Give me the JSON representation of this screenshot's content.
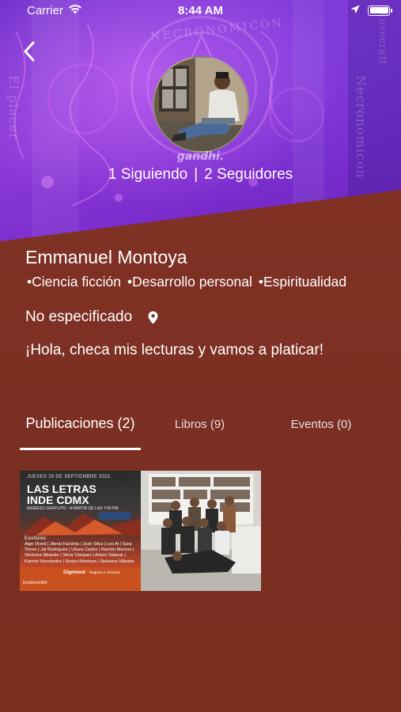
{
  "status_bar": {
    "carrier": "Carrier",
    "time": "8:44 AM",
    "battery_level": 1.0
  },
  "banner": {
    "brand_logo": "gandhi.",
    "top_text": "NECRONOMICON",
    "side_text_left": "El placer",
    "side_text_right": "Necronomicon",
    "side_text_right_small": "Lovecraft"
  },
  "profile": {
    "following_count": "1",
    "following_label": "Siguiendo",
    "followers_count": "2",
    "followers_label": "Seguidores",
    "separator": "|",
    "name": "Emmanuel Montoya",
    "interests": [
      "Ciencia ficción",
      "Desarrollo personal",
      "Espiritualidad"
    ],
    "location": "No especificado",
    "bio": "¡Hola, checa mis lecturas y vamos a platicar!"
  },
  "tabs": [
    {
      "label": "Publicaciones (2)",
      "active": true
    },
    {
      "label": "Libros (9)",
      "active": false
    },
    {
      "label": "Eventos (0)",
      "active": false
    }
  ],
  "post": {
    "poster": {
      "date": "JUEVES 29 DE SEPTIEMBRE 2022",
      "title_line1": "LAS LETRAS",
      "title_line2": "INDE CDMX",
      "subtitle": "INGRESO GRATUITO · A PARTIR DE LAS 7:00 PM",
      "writers_label": "Escritores:",
      "writers": "Alge Olvett | Jiterat Farishta | José Silva | Leo Al | Sara Torres | Jat Rodriguez | Ulises Castro | Ramón Moreno | Verónica Miranda | Silvia Vázquez | Arturo Salazar | Karmín Hernández | Serjoo Montoya | Siekeera Villadan",
      "brand": "Gigmeout",
      "handle": "Escritores900",
      "links_label": "Registro e informes"
    }
  },
  "colors": {
    "background": "#7d3024",
    "banner_purple": "#7a2ccc",
    "text": "#ffffff",
    "poster_orange": "#c9501f"
  },
  "icons": {
    "back": "chevron-left-icon",
    "wifi": "wifi-icon",
    "location_arrow": "location-arrow-icon",
    "battery": "battery-icon",
    "pin": "location-pin-icon"
  }
}
